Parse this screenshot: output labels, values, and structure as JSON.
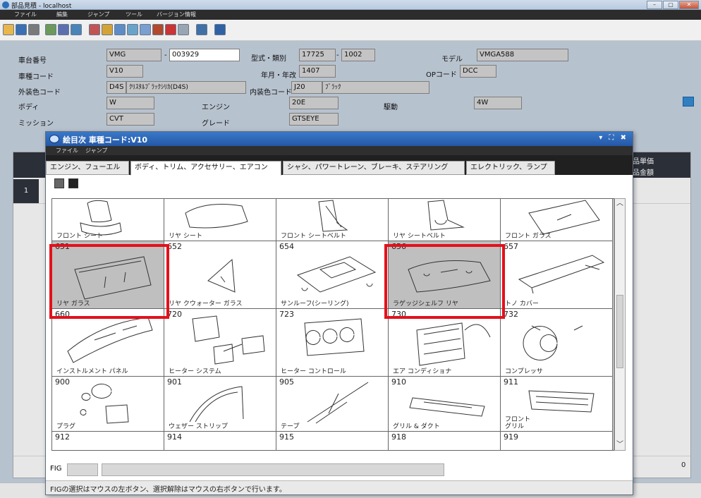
{
  "window": {
    "title": "部品見積 - localhost",
    "menu": [
      "ファイル",
      "編集",
      "ジャンプ",
      "ツール",
      "バージョン情報"
    ]
  },
  "header": {
    "frame_no_label": "車台番号",
    "frame_prefix": "VMG",
    "frame_sep": "-",
    "frame_no": "003929",
    "model_type_label": "型式・類別",
    "model_type": "17725",
    "model_type_sep": "-",
    "model_class": "1002",
    "model_label": "モデル",
    "model": "VMGA588",
    "vehicle_code_label": "車種コード",
    "vehicle_code": "V10",
    "year_month_label": "年月・年改",
    "year_month": "1407",
    "op_code_label": "OPコード",
    "op_code": "DCC",
    "exterior_color_label": "外装色コード",
    "exterior_color_code": "D4S",
    "exterior_color_name": "ｸﾘｽﾀﾙﾌﾞﾗｯｸｼﾘｶ(D4S)",
    "interior_color_label": "内装色コード",
    "interior_color_code": "J20",
    "interior_color_name": "ﾌﾞﾗｯｸ",
    "body_label": "ボディ",
    "body": "W",
    "engine_label": "エンジン",
    "engine": "20E",
    "drive_label": "駆動",
    "drive": "4W",
    "transmission_label": "ミッション",
    "transmission": "CVT",
    "grade_label": "グレード",
    "grade": "GTSEYE"
  },
  "background_table": {
    "header_1": "品単価",
    "header_2": "品金額",
    "row_1": "1",
    "total_value": "0"
  },
  "dialog": {
    "title": "絵目次 車種コード:V10",
    "controls": "▾ ⛶ ✖",
    "menu": [
      "ファイル",
      "ジャンプ"
    ],
    "tabs": [
      {
        "label": "エンジン、フューエル",
        "active": false
      },
      {
        "label": "ボディ、トリム、アクセサリー、エアコン",
        "active": true
      },
      {
        "label": "シャシ、パワートレーン、ブレーキ、ステアリング",
        "active": false
      },
      {
        "label": "エレクトリック、ランプ",
        "active": false
      }
    ],
    "fig_label": "FIG",
    "status": "FIGの選択はマウスの左ボタン、選択解除はマウスの右ボタンで行います。",
    "rows": [
      [
        {
          "num": "",
          "name": "フロント シート"
        },
        {
          "num": "",
          "name": "リヤ シート"
        },
        {
          "num": "",
          "name": "フロント シートベルト"
        },
        {
          "num": "",
          "name": "リヤ シートベルト"
        },
        {
          "num": "",
          "name": "フロント ガラス"
        }
      ],
      [
        {
          "num": "651",
          "name": "リヤ ガラス",
          "selected": true
        },
        {
          "num": "652",
          "name": "リヤ クウォーター ガラス"
        },
        {
          "num": "654",
          "name": "サンルーフ(シーリング)"
        },
        {
          "num": "656",
          "name": "ラゲッジシェルフ リヤ",
          "selected": true
        },
        {
          "num": "657",
          "name": "トノ カバー"
        }
      ],
      [
        {
          "num": "660",
          "name": "インストルメント パネル"
        },
        {
          "num": "720",
          "name": "ヒーター システム"
        },
        {
          "num": "723",
          "name": "ヒーター コントロール"
        },
        {
          "num": "730",
          "name": "エア コンディショナ"
        },
        {
          "num": "732",
          "name": "コンプレッサ"
        }
      ],
      [
        {
          "num": "900",
          "name": "プラグ"
        },
        {
          "num": "901",
          "name": "ウェザー ストリップ"
        },
        {
          "num": "905",
          "name": "テープ"
        },
        {
          "num": "910",
          "name": "グリル & ダクト"
        },
        {
          "num": "911",
          "name": "フロント\nグリル"
        }
      ],
      [
        {
          "num": "912",
          "name": ""
        },
        {
          "num": "914",
          "name": ""
        },
        {
          "num": "915",
          "name": ""
        },
        {
          "num": "918",
          "name": ""
        },
        {
          "num": "919",
          "name": ""
        }
      ]
    ]
  },
  "colors": {
    "highlight": "#e3111b",
    "selected_cell": "#bfbfbf",
    "dialog_title": "#2458a6",
    "header_bg": "#b7c2cf",
    "field_bg": "#c4c4c4"
  }
}
